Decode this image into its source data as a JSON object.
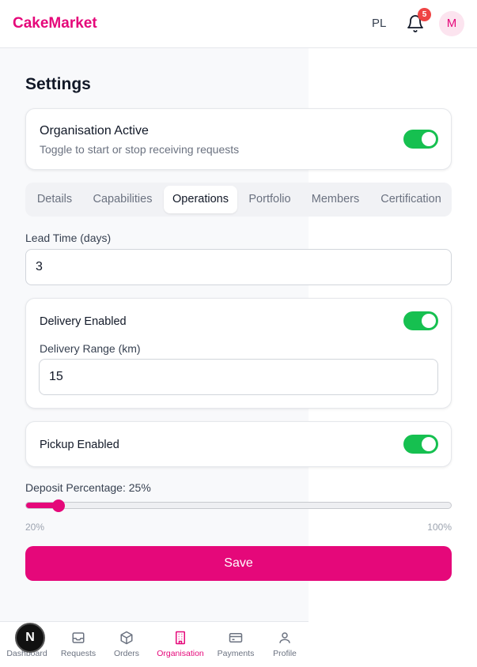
{
  "header": {
    "logo": "CakeMarket",
    "language": "PL",
    "notifications_count": "5",
    "avatar_initial": "M"
  },
  "page": {
    "title": "Settings"
  },
  "organisation_active": {
    "title": "Organisation Active",
    "subtitle": "Toggle to start or stop receiving requests",
    "enabled": true
  },
  "tabs": [
    {
      "label": "Details",
      "active": false
    },
    {
      "label": "Capabilities",
      "active": false
    },
    {
      "label": "Operations",
      "active": true
    },
    {
      "label": "Portfolio",
      "active": false
    },
    {
      "label": "Members",
      "active": false
    },
    {
      "label": "Certification",
      "active": false
    }
  ],
  "form": {
    "lead_time_label": "Lead Time (days)",
    "lead_time_value": "3",
    "delivery_enabled_label": "Delivery Enabled",
    "delivery_enabled": true,
    "delivery_range_label": "Delivery Range (km)",
    "delivery_range_value": "15",
    "pickup_enabled_label": "Pickup Enabled",
    "pickup_enabled": true,
    "deposit_label": "Deposit Percentage: 25%",
    "deposit_value": 25,
    "deposit_min_label": "20%",
    "deposit_max_label": "100%",
    "deposit_min": 20,
    "deposit_max": 100,
    "save_label": "Save"
  },
  "bottom_nav": [
    {
      "label": "Dashboard",
      "icon": "dashboard-icon",
      "active": false
    },
    {
      "label": "Requests",
      "icon": "inbox-icon",
      "active": false
    },
    {
      "label": "Orders",
      "icon": "box-icon",
      "active": false
    },
    {
      "label": "Organisation",
      "icon": "building-icon",
      "active": true
    },
    {
      "label": "Payments",
      "icon": "credit-card-icon",
      "active": false
    },
    {
      "label": "Profile",
      "icon": "user-icon",
      "active": false
    }
  ],
  "dev_badge": "N",
  "colors": {
    "brand": "#e5087a",
    "toggle_on": "#16c050",
    "badge": "#ef4444"
  }
}
